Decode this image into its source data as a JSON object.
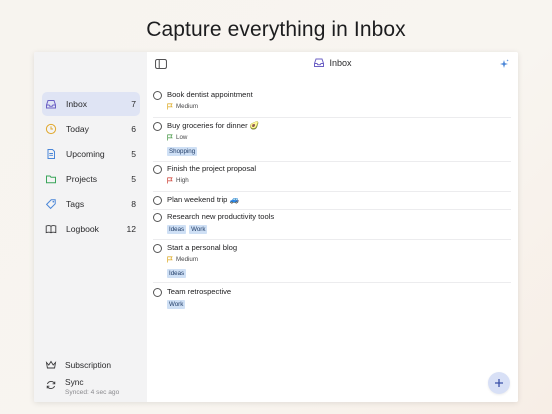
{
  "headline": "Capture everything in Inbox",
  "sidebar": {
    "items": [
      {
        "label": "Inbox",
        "count": "7",
        "icon": "inbox-icon",
        "active": true
      },
      {
        "label": "Today",
        "count": "6",
        "icon": "clock-icon"
      },
      {
        "label": "Upcoming",
        "count": "5",
        "icon": "document-icon"
      },
      {
        "label": "Projects",
        "count": "5",
        "icon": "folder-icon"
      },
      {
        "label": "Tags",
        "count": "8",
        "icon": "tag-icon"
      },
      {
        "label": "Logbook",
        "count": "12",
        "icon": "book-icon"
      }
    ],
    "subscription_label": "Subscription",
    "sync_label": "Sync",
    "sync_status": "Synced: 4 sec ago"
  },
  "header": {
    "title": "Inbox"
  },
  "tasks": [
    {
      "title": "Book dentist appointment",
      "priority": "Medium"
    },
    {
      "title": "Buy groceries for dinner 🥑",
      "priority": "Low",
      "tags": [
        "Shopping"
      ]
    },
    {
      "title": "Finish the project proposal",
      "priority": "High"
    },
    {
      "title": "Plan weekend trip 🚙"
    },
    {
      "title": "Research new productivity tools",
      "tags": [
        "Ideas",
        "Work"
      ]
    },
    {
      "title": "Start a personal blog",
      "priority": "Medium",
      "tags": [
        "Ideas"
      ]
    },
    {
      "title": "Team retrospective",
      "tags": [
        "Work"
      ]
    }
  ],
  "colors": {
    "accent": "#5b6fc4",
    "tag_background": "#cfe0f5",
    "priority_low": "#5aa35a",
    "priority_medium": "#e0b23a",
    "priority_high": "#d2554a",
    "active_item": "#dfe4f4"
  }
}
